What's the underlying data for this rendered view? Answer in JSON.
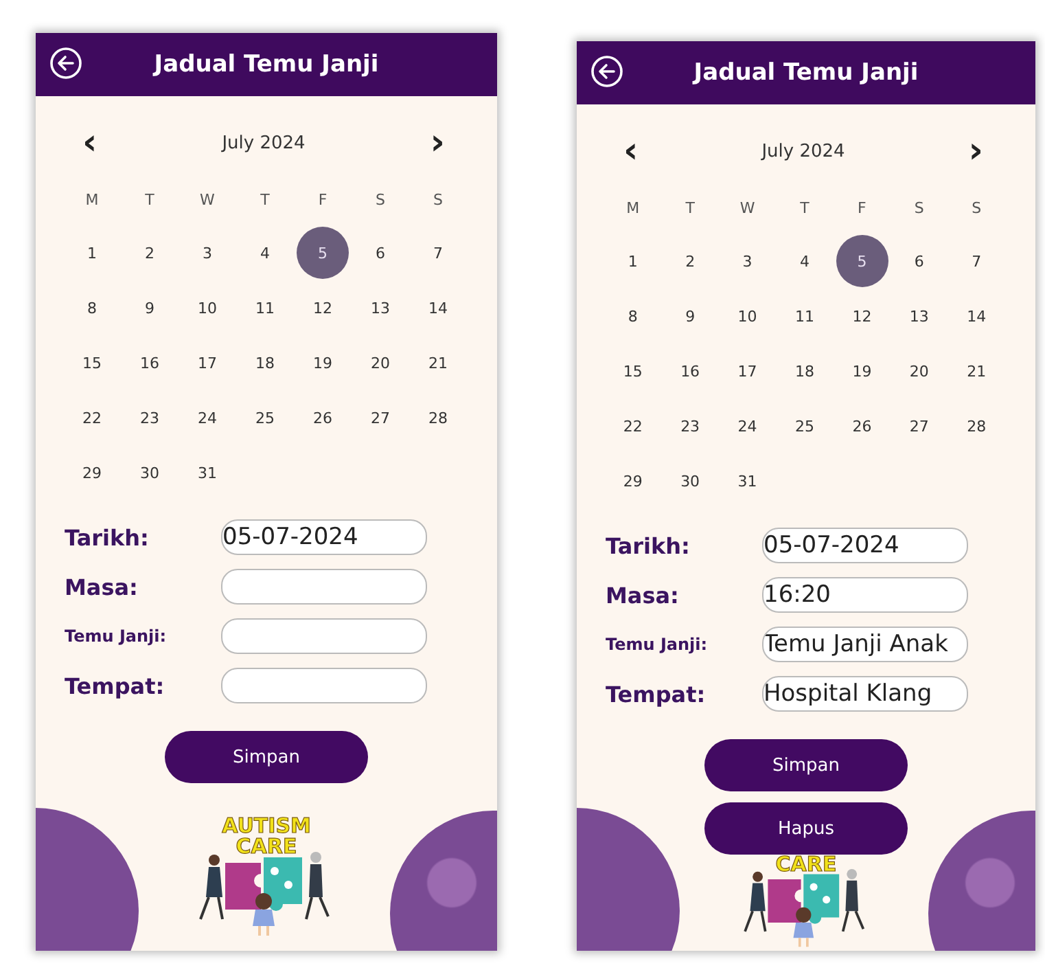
{
  "screens": [
    {
      "header": {
        "title": "Jadual Temu Janji"
      },
      "calendar": {
        "month": "July 2024",
        "prev": "‹",
        "next": "›",
        "weekdays": [
          "M",
          "T",
          "W",
          "T",
          "F",
          "S",
          "S"
        ],
        "days": [
          {
            "label": "1",
            "selected": false
          },
          {
            "label": "2",
            "selected": false
          },
          {
            "label": "3",
            "selected": false
          },
          {
            "label": "4",
            "selected": false
          },
          {
            "label": "5",
            "selected": true
          },
          {
            "label": "6",
            "selected": false
          },
          {
            "label": "7",
            "selected": false
          },
          {
            "label": "8",
            "selected": false
          },
          {
            "label": "9",
            "selected": false
          },
          {
            "label": "10",
            "selected": false
          },
          {
            "label": "11",
            "selected": false
          },
          {
            "label": "12",
            "selected": false
          },
          {
            "label": "13",
            "selected": false
          },
          {
            "label": "14",
            "selected": false
          },
          {
            "label": "15",
            "selected": false
          },
          {
            "label": "16",
            "selected": false
          },
          {
            "label": "17",
            "selected": false
          },
          {
            "label": "18",
            "selected": false
          },
          {
            "label": "19",
            "selected": false
          },
          {
            "label": "20",
            "selected": false
          },
          {
            "label": "21",
            "selected": false
          },
          {
            "label": "22",
            "selected": false
          },
          {
            "label": "23",
            "selected": false
          },
          {
            "label": "24",
            "selected": false
          },
          {
            "label": "25",
            "selected": false
          },
          {
            "label": "26",
            "selected": false
          },
          {
            "label": "27",
            "selected": false
          },
          {
            "label": "28",
            "selected": false
          },
          {
            "label": "29",
            "selected": false
          },
          {
            "label": "30",
            "selected": false
          },
          {
            "label": "31",
            "selected": false
          }
        ]
      },
      "fields": [
        {
          "label": "Tarikh:",
          "kind": "regular",
          "value": "05-07-2024"
        },
        {
          "label": "Masa:",
          "kind": "regular"
        },
        {
          "label": "Temu Janji:",
          "kind": "small"
        },
        {
          "label": "Tempat:",
          "kind": "regular"
        }
      ],
      "buttons": [
        "Simpan"
      ],
      "logo": {
        "lines": [
          "AUTISM",
          "CARE"
        ]
      }
    },
    {
      "header": {
        "title": "Jadual Temu Janji"
      },
      "calendar": {
        "month": "July 2024",
        "prev": "‹",
        "next": "›",
        "weekdays": [
          "M",
          "T",
          "W",
          "T",
          "F",
          "S",
          "S"
        ],
        "days": [
          {
            "label": "1",
            "selected": false
          },
          {
            "label": "2",
            "selected": false
          },
          {
            "label": "3",
            "selected": false
          },
          {
            "label": "4",
            "selected": false
          },
          {
            "label": "5",
            "selected": true
          },
          {
            "label": "6",
            "selected": false
          },
          {
            "label": "7",
            "selected": false
          },
          {
            "label": "8",
            "selected": false
          },
          {
            "label": "9",
            "selected": false
          },
          {
            "label": "10",
            "selected": false
          },
          {
            "label": "11",
            "selected": false
          },
          {
            "label": "12",
            "selected": false
          },
          {
            "label": "13",
            "selected": false
          },
          {
            "label": "14",
            "selected": false
          },
          {
            "label": "15",
            "selected": false
          },
          {
            "label": "16",
            "selected": false
          },
          {
            "label": "17",
            "selected": false
          },
          {
            "label": "18",
            "selected": false
          },
          {
            "label": "19",
            "selected": false
          },
          {
            "label": "20",
            "selected": false
          },
          {
            "label": "21",
            "selected": false
          },
          {
            "label": "22",
            "selected": false
          },
          {
            "label": "23",
            "selected": false
          },
          {
            "label": "24",
            "selected": false
          },
          {
            "label": "25",
            "selected": false
          },
          {
            "label": "26",
            "selected": false
          },
          {
            "label": "27",
            "selected": false
          },
          {
            "label": "28",
            "selected": false
          },
          {
            "label": "29",
            "selected": false
          },
          {
            "label": "30",
            "selected": false
          },
          {
            "label": "31",
            "selected": false
          }
        ]
      },
      "fields": [
        {
          "label": "Tarikh:",
          "kind": "regular",
          "value": "05-07-2024"
        },
        {
          "label": "Masa:",
          "kind": "regular",
          "value": "16:20"
        },
        {
          "label": "Temu Janji:",
          "kind": "small",
          "value": "Temu Janji Anak"
        },
        {
          "label": "Tempat:",
          "kind": "regular",
          "value": "Hospital Klang"
        }
      ],
      "buttons": [
        "Simpan",
        "Hapus"
      ],
      "logo": {
        "lines": [
          "CARE"
        ]
      }
    }
  ]
}
